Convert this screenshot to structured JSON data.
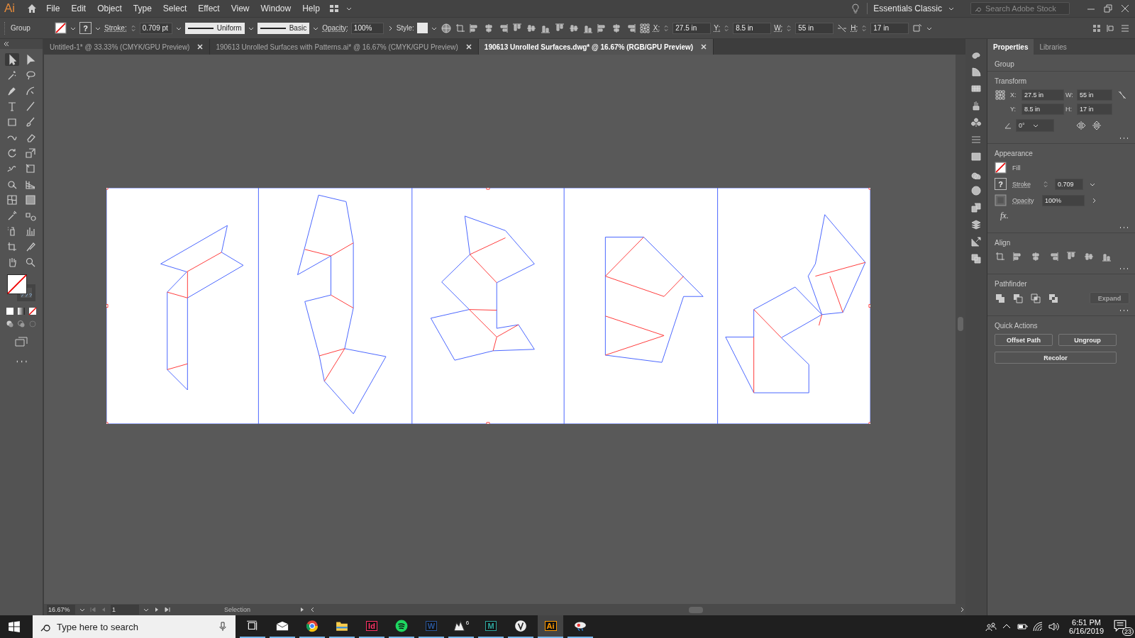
{
  "app": {
    "logo": "Ai"
  },
  "menu": [
    "File",
    "Edit",
    "Object",
    "Type",
    "Select",
    "Effect",
    "View",
    "Window",
    "Help"
  ],
  "workspace": "Essentials Classic",
  "search": {
    "placeholder": "Search Adobe Stock"
  },
  "control_bar": {
    "selection": "Group",
    "stroke_swatch": "?",
    "stroke_label": "Stroke:",
    "stroke_value": "0.709 pt",
    "profile": "Uniform",
    "brush": "Basic",
    "opacity_label": "Opacity:",
    "opacity": "100%",
    "style_label": "Style:",
    "x_label": "X:",
    "x": "27.5 in",
    "y_label": "Y:",
    "y": "8.5 in",
    "w_label": "W:",
    "w": "55 in",
    "h_label": "H:",
    "h": "17 in"
  },
  "tabs": [
    {
      "label": "Untitled-1* @ 33.33% (CMYK/GPU Preview)",
      "selected": false
    },
    {
      "label": "190613 Unrolled Surfaces with Patterns.ai* @ 16.67% (CMYK/GPU Preview)",
      "selected": false
    },
    {
      "label": "190613 Unrolled Surfaces.dwg* @ 16.67% (RGB/GPU Preview)",
      "selected": true
    }
  ],
  "toolbar": {
    "stroke_marks": [
      "?",
      "?",
      "?"
    ]
  },
  "panel": {
    "tabs": [
      {
        "label": "Properties",
        "selected": true
      },
      {
        "label": "Libraries",
        "selected": false
      }
    ],
    "object_type": "Group",
    "transform": {
      "title": "Transform",
      "fields": [
        {
          "label": "X:",
          "value": "27.5 in"
        },
        {
          "label": "W:",
          "value": "55 in"
        },
        {
          "label": "Y:",
          "value": "8.5 in"
        },
        {
          "label": "H:",
          "value": "17 in"
        }
      ],
      "angle": "0°"
    },
    "appearance": {
      "title": "Appearance",
      "fill_label": "Fill",
      "stroke_swatch": "?",
      "stroke_label": "Stroke",
      "stroke_value": "0.709",
      "opacity_label": "Opacity",
      "opacity_value": "100%",
      "fx": "fx."
    },
    "align": {
      "title": "Align"
    },
    "pathfinder": {
      "title": "Pathfinder",
      "expand": {
        "label": "Expand",
        "disabled": true
      }
    },
    "quick_actions": {
      "title": "Quick Actions",
      "buttons": [
        "Offset Path",
        "Ungroup",
        "Recolor"
      ]
    }
  },
  "status_bar": {
    "zoom": "16.67%",
    "artboard": "1",
    "tool": "Selection"
  },
  "taskbar": {
    "search_placeholder": "Type here to search",
    "apps": [
      {
        "kind": "task-view",
        "selected": false
      },
      {
        "kind": "mail",
        "selected": false
      },
      {
        "kind": "browser",
        "selected": false
      },
      {
        "kind": "folder",
        "selected": false
      },
      {
        "kind": "tile",
        "label": "Id",
        "color": "#ff3366",
        "selected": false
      },
      {
        "kind": "music",
        "selected": false
      },
      {
        "kind": "tile",
        "label": "W",
        "color": "#2b579a",
        "selected": false
      },
      {
        "kind": "rhino",
        "label": "6",
        "selected": false
      },
      {
        "kind": "tile",
        "label": "M",
        "color": "#2fa7a0",
        "selected": false
      },
      {
        "kind": "sphere",
        "selected": false
      },
      {
        "kind": "tile",
        "label": "Ai",
        "color": "#ff9a00",
        "selected": true
      },
      {
        "kind": "paint",
        "selected": false
      }
    ],
    "time": "6:51 PM",
    "date": "6/16/2019",
    "notifications": "23"
  }
}
